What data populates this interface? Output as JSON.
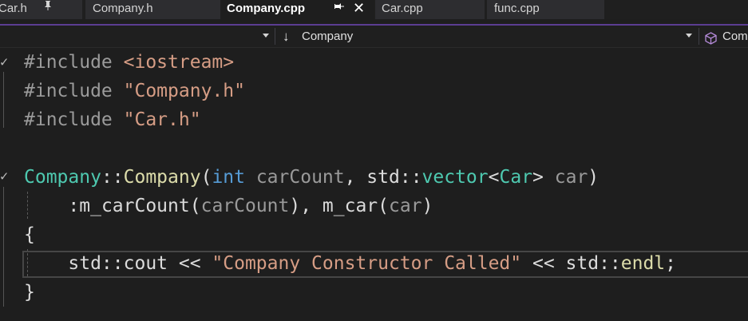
{
  "tabs": [
    {
      "label": "Car.h",
      "pin_icon": "pin-icon"
    },
    {
      "label": "Company.h"
    },
    {
      "label": "Company.cpp",
      "active": true,
      "pin_icon": "pin-icon",
      "close_icon": "close-icon"
    },
    {
      "label": "Car.cpp"
    },
    {
      "label": "func.cpp"
    }
  ],
  "glyphs": {
    "pin": "↤",
    "close": "✕",
    "arrow_down": "↓",
    "collapse": "✓"
  },
  "navbar": {
    "scope_dropdown_value": "",
    "class_dropdown_icon": "down-arrow-icon",
    "class_dropdown_value": "Company",
    "member_dropdown_icon": "cube-icon",
    "member_dropdown_value": "Com"
  },
  "colors": {
    "active_tab_accent": "#5b3d92",
    "type": "#4ec9b0",
    "keyword": "#569cd6",
    "string": "#d69d85",
    "function": "#dcdcaa"
  },
  "code": {
    "line1": {
      "directive": "#include",
      "space": " ",
      "target": "<iostream>"
    },
    "line2": {
      "directive": "#include",
      "space": " ",
      "target": "\"Company.h\""
    },
    "line3": {
      "directive": "#include",
      "space": " ",
      "target": "\"Car.h\""
    },
    "line5": {
      "class": "Company",
      "scope": "::",
      "ctor": "Company",
      "open": "(",
      "kw_int": "int",
      "param1": " carCount",
      "comma": ", std::",
      "vector": "vector",
      "lt": "<",
      "car_type": "Car",
      "gt": "> ",
      "param2": "car",
      "close": ")"
    },
    "line6": {
      "indent": "    :",
      "member1": "m_carCount",
      "open1": "(",
      "arg1": "carCount",
      "close1": "), ",
      "member2": "m_car",
      "open2": "(",
      "arg2": "car",
      "close2": ")"
    },
    "line7": {
      "text": "{"
    },
    "line8": {
      "indent": "    std::cout << ",
      "string": "\"Company Constructor Called\"",
      "mid": " << std::",
      "endl": "endl",
      "end": ";"
    },
    "line9": {
      "text": "}"
    }
  }
}
